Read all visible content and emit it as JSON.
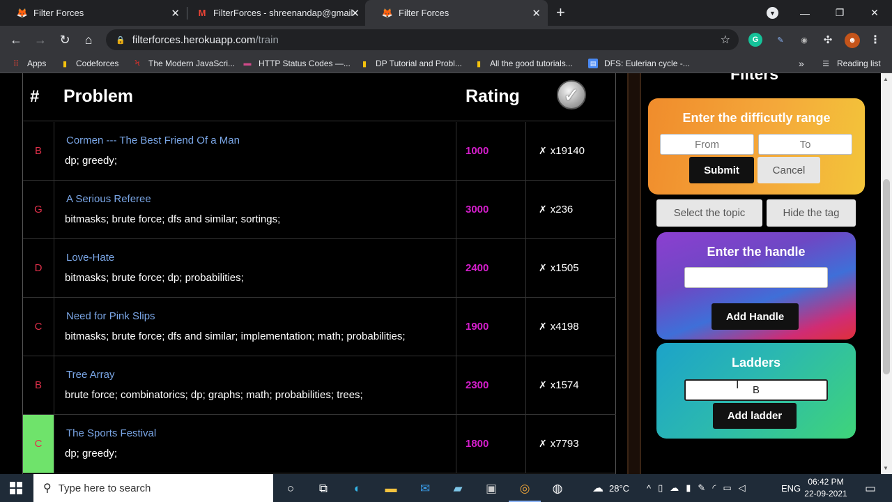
{
  "browser": {
    "tabs": [
      {
        "title": "Filter Forces",
        "icon": "fox-favicon",
        "active": false
      },
      {
        "title": "FilterForces - shreenandap@gmail.c",
        "icon": "gmail-favicon",
        "active": false
      },
      {
        "title": "Filter Forces",
        "icon": "fox-favicon",
        "active": true
      }
    ],
    "url_host": "filterforces.herokuapp.com",
    "url_path": "/train",
    "bookmarks": [
      {
        "label": "Apps",
        "icon": "apps-grid-icon"
      },
      {
        "label": "Codeforces",
        "icon": "codeforces-icon"
      },
      {
        "label": "The Modern JavaScri...",
        "icon": "js-info-icon"
      },
      {
        "label": "HTTP Status Codes —...",
        "icon": "http-icon"
      },
      {
        "label": "DP Tutorial and Probl...",
        "icon": "codeforces-icon"
      },
      {
        "label": "All the good tutorials...",
        "icon": "codeforces-icon"
      },
      {
        "label": "DFS: Eulerian cycle -...",
        "icon": "doc-icon"
      }
    ],
    "more_bookmarks": "»",
    "reading_list": "Reading list"
  },
  "table": {
    "headers": {
      "index": "#",
      "problem": "Problem",
      "rating": "Rating"
    },
    "rows": [
      {
        "index": "B",
        "index_color": "#e0304a",
        "solved": false,
        "name": "Cormen --- The Best Friend Of a Man",
        "tags": "dp; greedy;",
        "rating": "1000",
        "solved_count": "x19140"
      },
      {
        "index": "G",
        "index_color": "#e0304a",
        "solved": false,
        "name": "A Serious Referee",
        "tags": "bitmasks; brute force; dfs and similar; sortings;",
        "rating": "3000",
        "solved_count": "x236"
      },
      {
        "index": "D",
        "index_color": "#e0304a",
        "solved": false,
        "name": "Love-Hate",
        "tags": "bitmasks; brute force; dp; probabilities;",
        "rating": "2400",
        "solved_count": "x1505"
      },
      {
        "index": "C",
        "index_color": "#e0304a",
        "solved": false,
        "name": "Need for Pink Slips",
        "tags": "bitmasks; brute force; dfs and similar; implementation; math; probabilities;",
        "rating": "1900",
        "solved_count": "x4198"
      },
      {
        "index": "B",
        "index_color": "#e0304a",
        "solved": false,
        "name": "Tree Array",
        "tags": "brute force; combinatorics; dp; graphs; math; probabilities; trees;",
        "rating": "2300",
        "solved_count": "x1574"
      },
      {
        "index": "C",
        "index_color": "#e0304a",
        "solved": true,
        "name": "The Sports Festival",
        "tags": "dp; greedy;",
        "rating": "1800",
        "solved_count": "x7793"
      }
    ]
  },
  "filters": {
    "title": "Filters",
    "range": {
      "title": "Enter the difficutly range",
      "from_placeholder": "From",
      "to_placeholder": "To",
      "submit": "Submit",
      "cancel": "Cancel"
    },
    "select_topic": "Select the topic",
    "hide_tag": "Hide the tag",
    "handle": {
      "title": "Enter the handle",
      "value": "",
      "button": "Add Handle"
    },
    "ladders": {
      "title": "Ladders",
      "value": "B",
      "button": "Add ladder"
    }
  },
  "taskbar": {
    "search_placeholder": "Type here to search",
    "weather": "28°C",
    "language": "ENG",
    "time": "06:42 PM",
    "date": "22-09-2021"
  },
  "colors": {
    "rating": "#d41ecb",
    "problem_link": "#7aa6e6",
    "solved_cell": "#6fe36b"
  }
}
